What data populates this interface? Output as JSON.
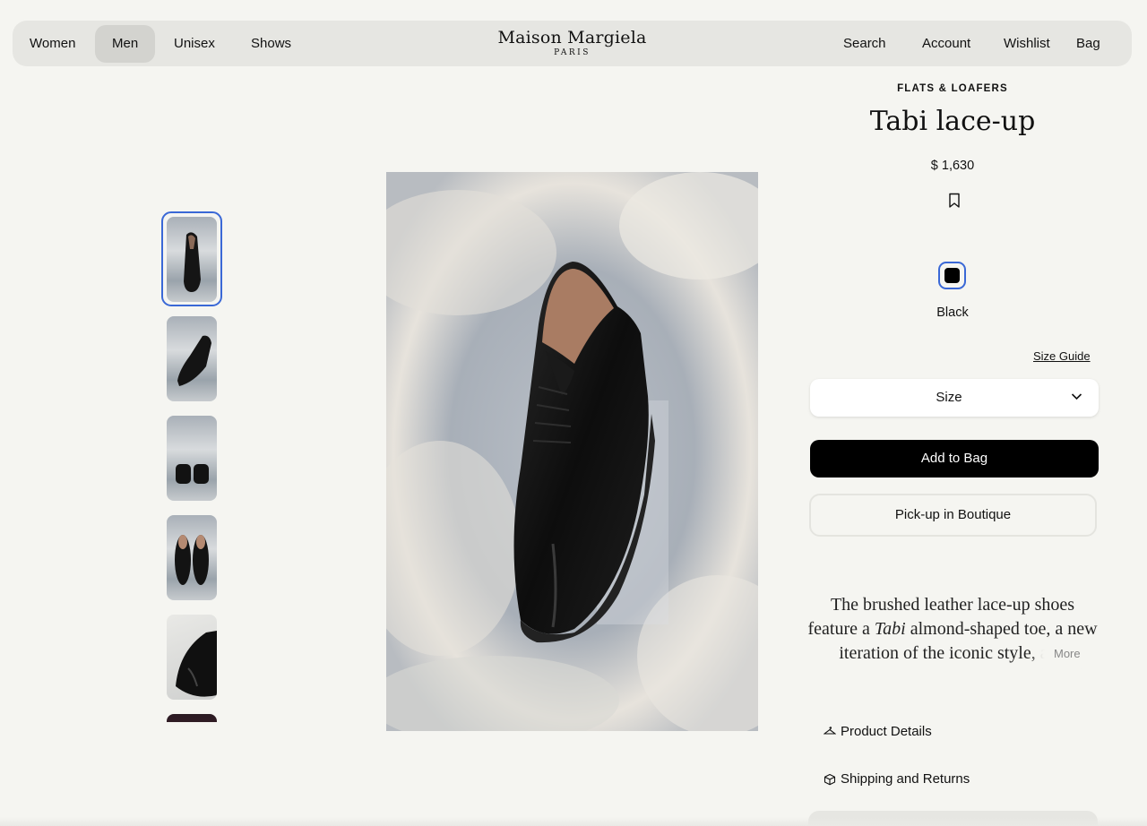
{
  "nav": {
    "left": [
      {
        "label": "Women",
        "active": false
      },
      {
        "label": "Men",
        "active": true
      },
      {
        "label": "Unisex",
        "active": false
      },
      {
        "label": "Shows",
        "active": false
      }
    ],
    "brand": {
      "name": "Maison Margiela",
      "city": "PARIS"
    },
    "right": [
      {
        "label": "Search"
      },
      {
        "label": "Account"
      },
      {
        "label": "Wishlist"
      },
      {
        "label": "Bag"
      }
    ]
  },
  "gallery": {
    "thumbnail_count_visible": 6,
    "selected_index": 0
  },
  "product": {
    "category": "FLATS & LOAFERS",
    "title": "Tabi lace-up",
    "price": "$ 1,630",
    "color": {
      "name": "Black",
      "swatch": "#000000"
    },
    "size_guide": "Size Guide",
    "size_placeholder": "Size",
    "add_to_bag": "Add to Bag",
    "pickup": "Pick-up in Boutique",
    "description": {
      "part1": "The brushed leather lace-up shoes feature a ",
      "italic": "Tabi",
      "part2": " almond-shaped toe, a new iteration of the iconic style, and",
      "more": "More"
    },
    "accordion": [
      {
        "label": "Product Details",
        "icon": "hanger-icon"
      },
      {
        "label": "Shipping and Returns",
        "icon": "box-icon"
      }
    ]
  },
  "colors": {
    "accent": "#3a68d6",
    "background": "#f5f5f1",
    "nav_bg": "#e6e6e2"
  }
}
